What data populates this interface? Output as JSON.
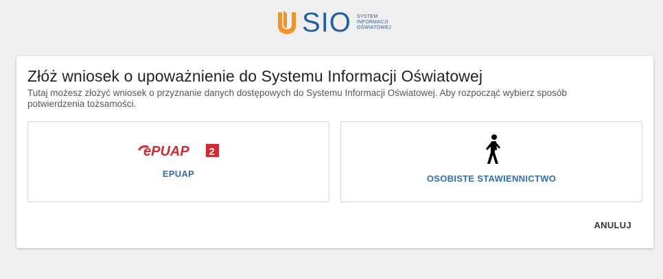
{
  "header": {
    "logo_text": "SIO",
    "logo_subtitle": [
      "SYSTEM",
      "INFORMACJI",
      "OŚWIATOWEJ"
    ]
  },
  "dialog": {
    "title": "Złóż wniosek o upoważnienie do Systemu Informacji Oświatowej",
    "description": "Tutaj możesz złożyć wniosek o przyznanie danych dostępowych do Systemu Informacji Oświatowej. Aby rozpocząć wybierz sposób potwierdzenia tożsamości.",
    "options": [
      {
        "label": "EPUAP",
        "icon": "epuap-logo",
        "logo_text": "ePUAP",
        "logo_badge": "2"
      },
      {
        "label": "OSOBISTE STAWIENNICTWO",
        "icon": "walking-person-icon"
      }
    ],
    "cancel_label": "ANULUJ"
  },
  "colors": {
    "brand_blue": "#1d5fa8",
    "brand_orange": "#f39322",
    "link_blue": "#2f6eb5",
    "epuap_red": "#d6282f",
    "background": "#efefef"
  }
}
